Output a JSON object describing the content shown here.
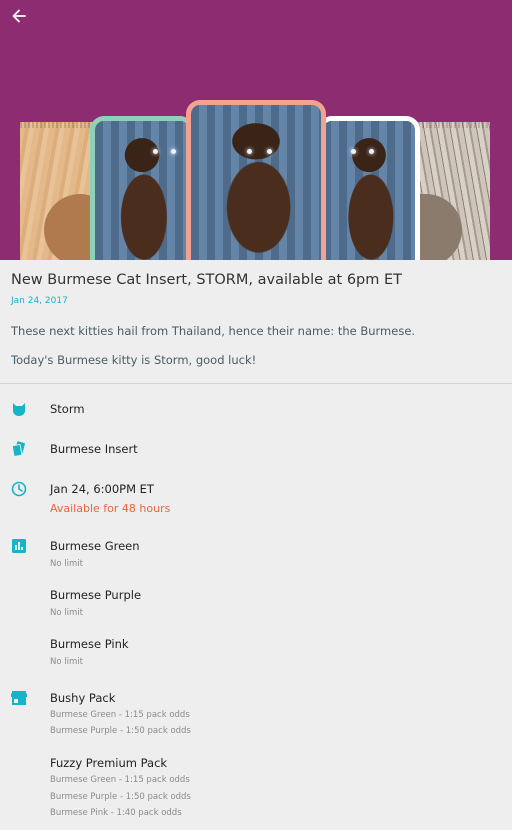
{
  "header": {
    "back_icon": "arrow-left-icon"
  },
  "colors": {
    "hero_background": "#8e2c72",
    "accent": "#16b3c9",
    "availability": "#e8663d",
    "card_green": "#8ed1b9",
    "card_pink": "#f1a38f",
    "card_purple": "#ffffff"
  },
  "article": {
    "title": "New Burmese Cat Insert, STORM, available at 6pm ET",
    "date": "Jan 24, 2017",
    "paragraphs": [
      "These next kitties hail from Thailand, hence their name: the Burmese.",
      "Today's Burmese kitty is Storm, good luck!"
    ]
  },
  "details": {
    "cat": {
      "icon": "cat-head-icon",
      "label": "Storm"
    },
    "insert": {
      "icon": "cards-icon",
      "label": "Burmese Insert"
    },
    "release": {
      "icon": "clock-icon",
      "label": "Jan 24, 6:00PM ET",
      "availability": "Available for 48 hours"
    },
    "variants": {
      "icon": "bar-chart-icon",
      "items": [
        {
          "name": "Burmese Green",
          "limit": "No limit"
        },
        {
          "name": "Burmese Purple",
          "limit": "No limit"
        },
        {
          "name": "Burmese Pink",
          "limit": "No limit"
        }
      ]
    },
    "packs": {
      "icon": "store-icon",
      "items": [
        {
          "name": "Bushy Pack",
          "odds": [
            "Burmese Green - 1:15 pack odds",
            "Burmese Purple - 1:50 pack odds"
          ]
        },
        {
          "name": "Fuzzy Premium Pack",
          "odds": [
            "Burmese Green - 1:15 pack odds",
            "Burmese Purple - 1:50 pack odds",
            "Burmese Pink - 1:40 pack odds"
          ]
        }
      ]
    }
  }
}
